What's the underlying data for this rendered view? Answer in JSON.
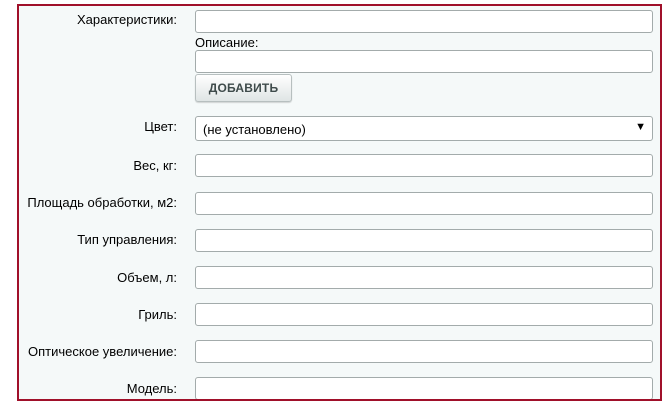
{
  "form": {
    "characteristics": {
      "label": "Характеристики:",
      "value": "",
      "description_label": "Описание:",
      "description_value": "",
      "add_button": "ДОБАВИТЬ"
    },
    "color": {
      "label": "Цвет:",
      "selected": "(не установлено)"
    },
    "fields": [
      {
        "label": "Вес, кг:",
        "value": ""
      },
      {
        "label": "Площадь обработки, м2:",
        "value": ""
      },
      {
        "label": "Тип управления:",
        "value": ""
      },
      {
        "label": "Объем, л:",
        "value": ""
      },
      {
        "label": "Гриль:",
        "value": ""
      },
      {
        "label": "Оптическое увеличение:",
        "value": ""
      },
      {
        "label": "Модель:",
        "value": ""
      }
    ]
  },
  "colors": {
    "frame_border": "#a0102a",
    "panel_background": "#f5f9f9"
  }
}
